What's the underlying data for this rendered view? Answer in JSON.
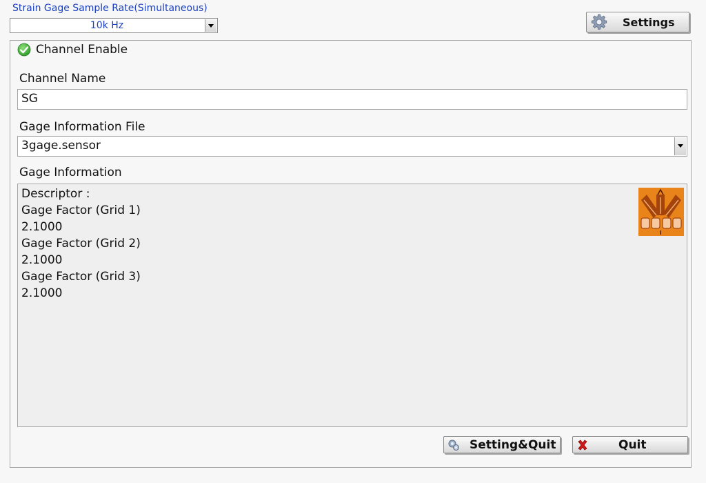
{
  "sample_rate": {
    "label": "Strain Gage Sample Rate(Simultaneous)",
    "selected": "10k Hz"
  },
  "toolbar": {
    "settings_label": "Settings"
  },
  "channel": {
    "enable_label": "Channel Enable",
    "enabled": true,
    "name_label": "Channel Name",
    "name_value": "SG",
    "file_label": "Gage Information File",
    "file_value": "3gage.sensor"
  },
  "gage_info": {
    "label": "Gage Information",
    "lines": [
      "Descriptor :",
      "Gage Factor (Grid 1)",
      "2.1000",
      "Gage Factor (Grid 2)",
      "2.1000",
      "Gage Factor (Grid 3)",
      "2.1000"
    ]
  },
  "footer": {
    "setting_quit_label": "Setting&Quit",
    "quit_label": "Quit"
  },
  "icons": {
    "settings": "gear-icon",
    "enable": "check-circle-icon",
    "setting_quit": "gear-small-icon",
    "quit": "red-x-icon",
    "gage": "strain-gage-rosette-image"
  },
  "colors": {
    "accent_text": "#1a3fbf",
    "check_green": "#3aa935",
    "quit_red": "#d01818",
    "gage_orange": "#e8841a"
  }
}
